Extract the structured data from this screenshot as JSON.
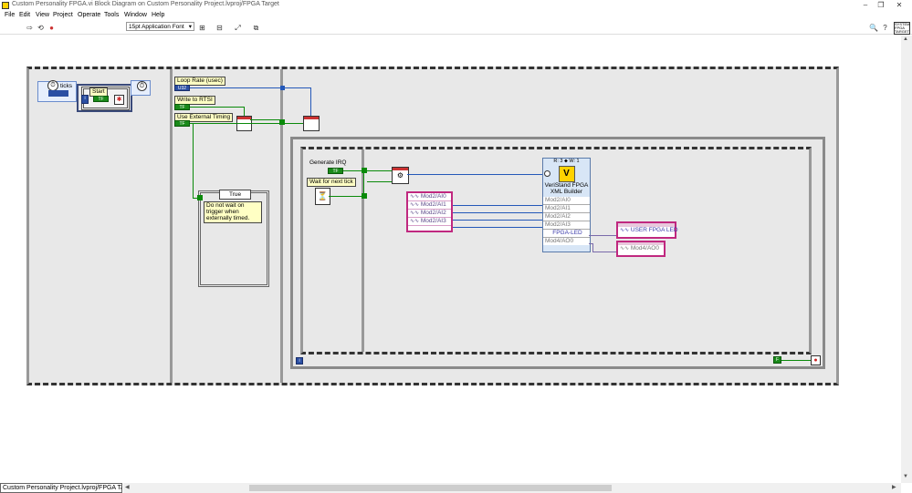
{
  "window": {
    "title": "Custom Personality FPGA.vi Block Diagram on Custom Personality Project.lvproj/FPGA Target",
    "minimize": "–",
    "restore": "❐",
    "close": "✕"
  },
  "menu": [
    "File",
    "Edit",
    "View",
    "Project",
    "Operate",
    "Tools",
    "Window",
    "Help"
  ],
  "toolbar": {
    "font_select": "15pt Application Font",
    "font_arrow": "▾",
    "search_glyph": "🔍",
    "help_glyph": "?"
  },
  "context_help": {
    "lines": [
      "SYSTEM",
      "FPGA",
      "TARGET"
    ]
  },
  "diagram": {
    "ticks_label": "ticks",
    "timing_glyph": "⏱",
    "start_label": "Start",
    "tf": "TF",
    "i_terminal": "i",
    "loop_rate_label": "Loop Rate (usec)",
    "loop_rate_type": "U32",
    "write_rtsi_label": "Write to  RTSI",
    "use_ext_timing_label": "Use External Timing",
    "case_selector": "True",
    "case_comment": "Do not wait on trigger when externally timed.",
    "generate_irq_label": "Generate IRQ",
    "wait_tick_label": "Wait for next tick",
    "inputs": [
      "Mod2/AI0",
      "Mod2/AI1",
      "Mod2/AI2",
      "Mod2/AI3"
    ],
    "veristand": {
      "header": "R: 3  ⬥  W: 1",
      "title_line1": "VeriStand FPGA",
      "title_line2": "XML Builder",
      "rows": [
        "Mod2/AI0",
        "Mod2/AI1",
        "Mod2/AI2",
        "Mod2/AI3",
        "FPGA-LED",
        "Mod4/AO0"
      ]
    },
    "out_led": "USER FPGA LED",
    "out_ao": "Mod4/AO0",
    "stop_f": "F"
  },
  "statusbar": {
    "path": "Custom Personality Project.lvproj/FPGA Target"
  },
  "colors": {
    "u32_wire": "#2458b8",
    "bool_wire": "#0a8a0a",
    "io_wire": "#7a6aaa",
    "io_border": "#c0287f"
  }
}
